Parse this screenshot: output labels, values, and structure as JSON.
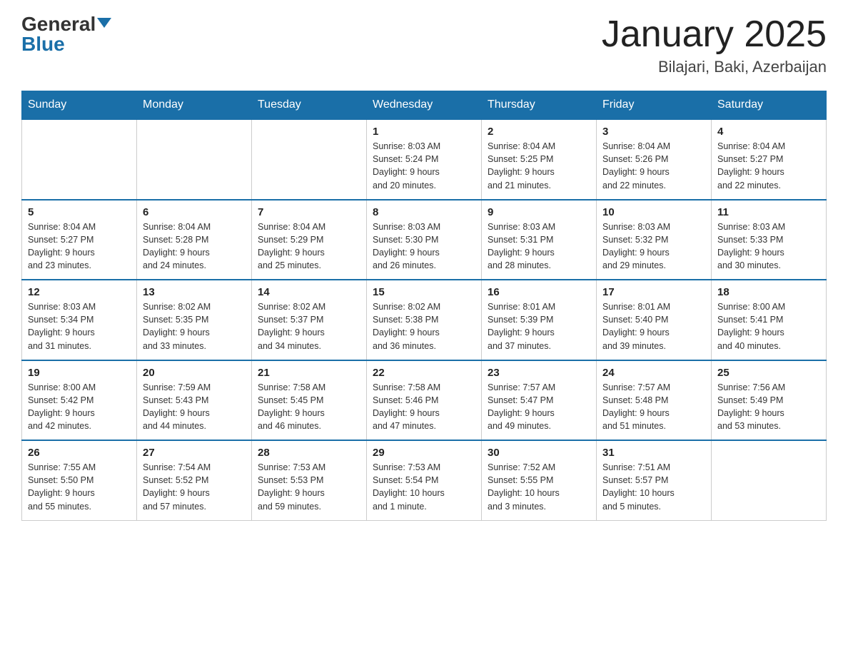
{
  "header": {
    "logo_general": "General",
    "logo_blue": "Blue",
    "month_title": "January 2025",
    "location": "Bilajari, Baki, Azerbaijan"
  },
  "days_of_week": [
    "Sunday",
    "Monday",
    "Tuesday",
    "Wednesday",
    "Thursday",
    "Friday",
    "Saturday"
  ],
  "weeks": [
    [
      {
        "day": "",
        "info": ""
      },
      {
        "day": "",
        "info": ""
      },
      {
        "day": "",
        "info": ""
      },
      {
        "day": "1",
        "info": "Sunrise: 8:03 AM\nSunset: 5:24 PM\nDaylight: 9 hours\nand 20 minutes."
      },
      {
        "day": "2",
        "info": "Sunrise: 8:04 AM\nSunset: 5:25 PM\nDaylight: 9 hours\nand 21 minutes."
      },
      {
        "day": "3",
        "info": "Sunrise: 8:04 AM\nSunset: 5:26 PM\nDaylight: 9 hours\nand 22 minutes."
      },
      {
        "day": "4",
        "info": "Sunrise: 8:04 AM\nSunset: 5:27 PM\nDaylight: 9 hours\nand 22 minutes."
      }
    ],
    [
      {
        "day": "5",
        "info": "Sunrise: 8:04 AM\nSunset: 5:27 PM\nDaylight: 9 hours\nand 23 minutes."
      },
      {
        "day": "6",
        "info": "Sunrise: 8:04 AM\nSunset: 5:28 PM\nDaylight: 9 hours\nand 24 minutes."
      },
      {
        "day": "7",
        "info": "Sunrise: 8:04 AM\nSunset: 5:29 PM\nDaylight: 9 hours\nand 25 minutes."
      },
      {
        "day": "8",
        "info": "Sunrise: 8:03 AM\nSunset: 5:30 PM\nDaylight: 9 hours\nand 26 minutes."
      },
      {
        "day": "9",
        "info": "Sunrise: 8:03 AM\nSunset: 5:31 PM\nDaylight: 9 hours\nand 28 minutes."
      },
      {
        "day": "10",
        "info": "Sunrise: 8:03 AM\nSunset: 5:32 PM\nDaylight: 9 hours\nand 29 minutes."
      },
      {
        "day": "11",
        "info": "Sunrise: 8:03 AM\nSunset: 5:33 PM\nDaylight: 9 hours\nand 30 minutes."
      }
    ],
    [
      {
        "day": "12",
        "info": "Sunrise: 8:03 AM\nSunset: 5:34 PM\nDaylight: 9 hours\nand 31 minutes."
      },
      {
        "day": "13",
        "info": "Sunrise: 8:02 AM\nSunset: 5:35 PM\nDaylight: 9 hours\nand 33 minutes."
      },
      {
        "day": "14",
        "info": "Sunrise: 8:02 AM\nSunset: 5:37 PM\nDaylight: 9 hours\nand 34 minutes."
      },
      {
        "day": "15",
        "info": "Sunrise: 8:02 AM\nSunset: 5:38 PM\nDaylight: 9 hours\nand 36 minutes."
      },
      {
        "day": "16",
        "info": "Sunrise: 8:01 AM\nSunset: 5:39 PM\nDaylight: 9 hours\nand 37 minutes."
      },
      {
        "day": "17",
        "info": "Sunrise: 8:01 AM\nSunset: 5:40 PM\nDaylight: 9 hours\nand 39 minutes."
      },
      {
        "day": "18",
        "info": "Sunrise: 8:00 AM\nSunset: 5:41 PM\nDaylight: 9 hours\nand 40 minutes."
      }
    ],
    [
      {
        "day": "19",
        "info": "Sunrise: 8:00 AM\nSunset: 5:42 PM\nDaylight: 9 hours\nand 42 minutes."
      },
      {
        "day": "20",
        "info": "Sunrise: 7:59 AM\nSunset: 5:43 PM\nDaylight: 9 hours\nand 44 minutes."
      },
      {
        "day": "21",
        "info": "Sunrise: 7:58 AM\nSunset: 5:45 PM\nDaylight: 9 hours\nand 46 minutes."
      },
      {
        "day": "22",
        "info": "Sunrise: 7:58 AM\nSunset: 5:46 PM\nDaylight: 9 hours\nand 47 minutes."
      },
      {
        "day": "23",
        "info": "Sunrise: 7:57 AM\nSunset: 5:47 PM\nDaylight: 9 hours\nand 49 minutes."
      },
      {
        "day": "24",
        "info": "Sunrise: 7:57 AM\nSunset: 5:48 PM\nDaylight: 9 hours\nand 51 minutes."
      },
      {
        "day": "25",
        "info": "Sunrise: 7:56 AM\nSunset: 5:49 PM\nDaylight: 9 hours\nand 53 minutes."
      }
    ],
    [
      {
        "day": "26",
        "info": "Sunrise: 7:55 AM\nSunset: 5:50 PM\nDaylight: 9 hours\nand 55 minutes."
      },
      {
        "day": "27",
        "info": "Sunrise: 7:54 AM\nSunset: 5:52 PM\nDaylight: 9 hours\nand 57 minutes."
      },
      {
        "day": "28",
        "info": "Sunrise: 7:53 AM\nSunset: 5:53 PM\nDaylight: 9 hours\nand 59 minutes."
      },
      {
        "day": "29",
        "info": "Sunrise: 7:53 AM\nSunset: 5:54 PM\nDaylight: 10 hours\nand 1 minute."
      },
      {
        "day": "30",
        "info": "Sunrise: 7:52 AM\nSunset: 5:55 PM\nDaylight: 10 hours\nand 3 minutes."
      },
      {
        "day": "31",
        "info": "Sunrise: 7:51 AM\nSunset: 5:57 PM\nDaylight: 10 hours\nand 5 minutes."
      },
      {
        "day": "",
        "info": ""
      }
    ]
  ]
}
